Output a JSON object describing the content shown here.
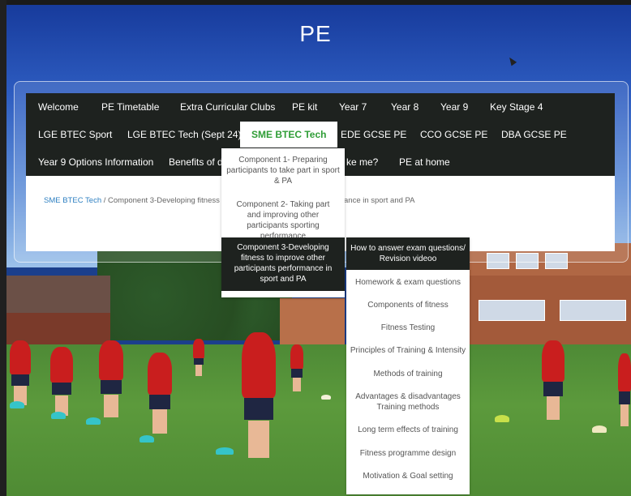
{
  "site": {
    "title": "PE"
  },
  "nav": {
    "row1": [
      "Welcome",
      "PE Timetable",
      "Extra Curricular Clubs",
      "PE kit",
      "Year 7",
      "Year 8",
      "Year 9",
      "Key Stage 4"
    ],
    "row2": [
      "LGE BTEC Sport",
      "LGE BTEC Tech (Sept 24)",
      "SME BTEC Tech",
      "EDE GCSE PE",
      "CCO GCSE PE",
      "DBA GCSE PE"
    ],
    "row3": [
      "Year 9 Options Information",
      "Benefits of do",
      "ke me?",
      "PE at home"
    ],
    "active": "SME BTEC Tech"
  },
  "breadcrumb": {
    "link": "SME BTEC Tech",
    "rest": " / Component 3-Developing fitness t",
    "trail": "ance in sport and PA"
  },
  "dropdown1": {
    "items": [
      "Component 1- Preparing participants to take part in sport & PA",
      "Component 2- Taking part and improving other participants sporting performance",
      "Component 3-Developing fitness to improve other participants performance in sport and PA"
    ]
  },
  "dropdown2": {
    "head": "How to answer exam questions/ Revision videoo",
    "items": [
      "Homework & exam questions",
      "Components of fitness",
      "Fitness Testing",
      "Principles of Training & Intensity",
      "Methods of training",
      "Advantages & disadvantages Training methods",
      "Long term effects of training",
      "Fitness programme design",
      "Motivation & Goal setting"
    ]
  },
  "colors": {
    "nav_bg": "#1e221f",
    "active_text": "#2f9d36",
    "link": "#2d7fc1"
  }
}
